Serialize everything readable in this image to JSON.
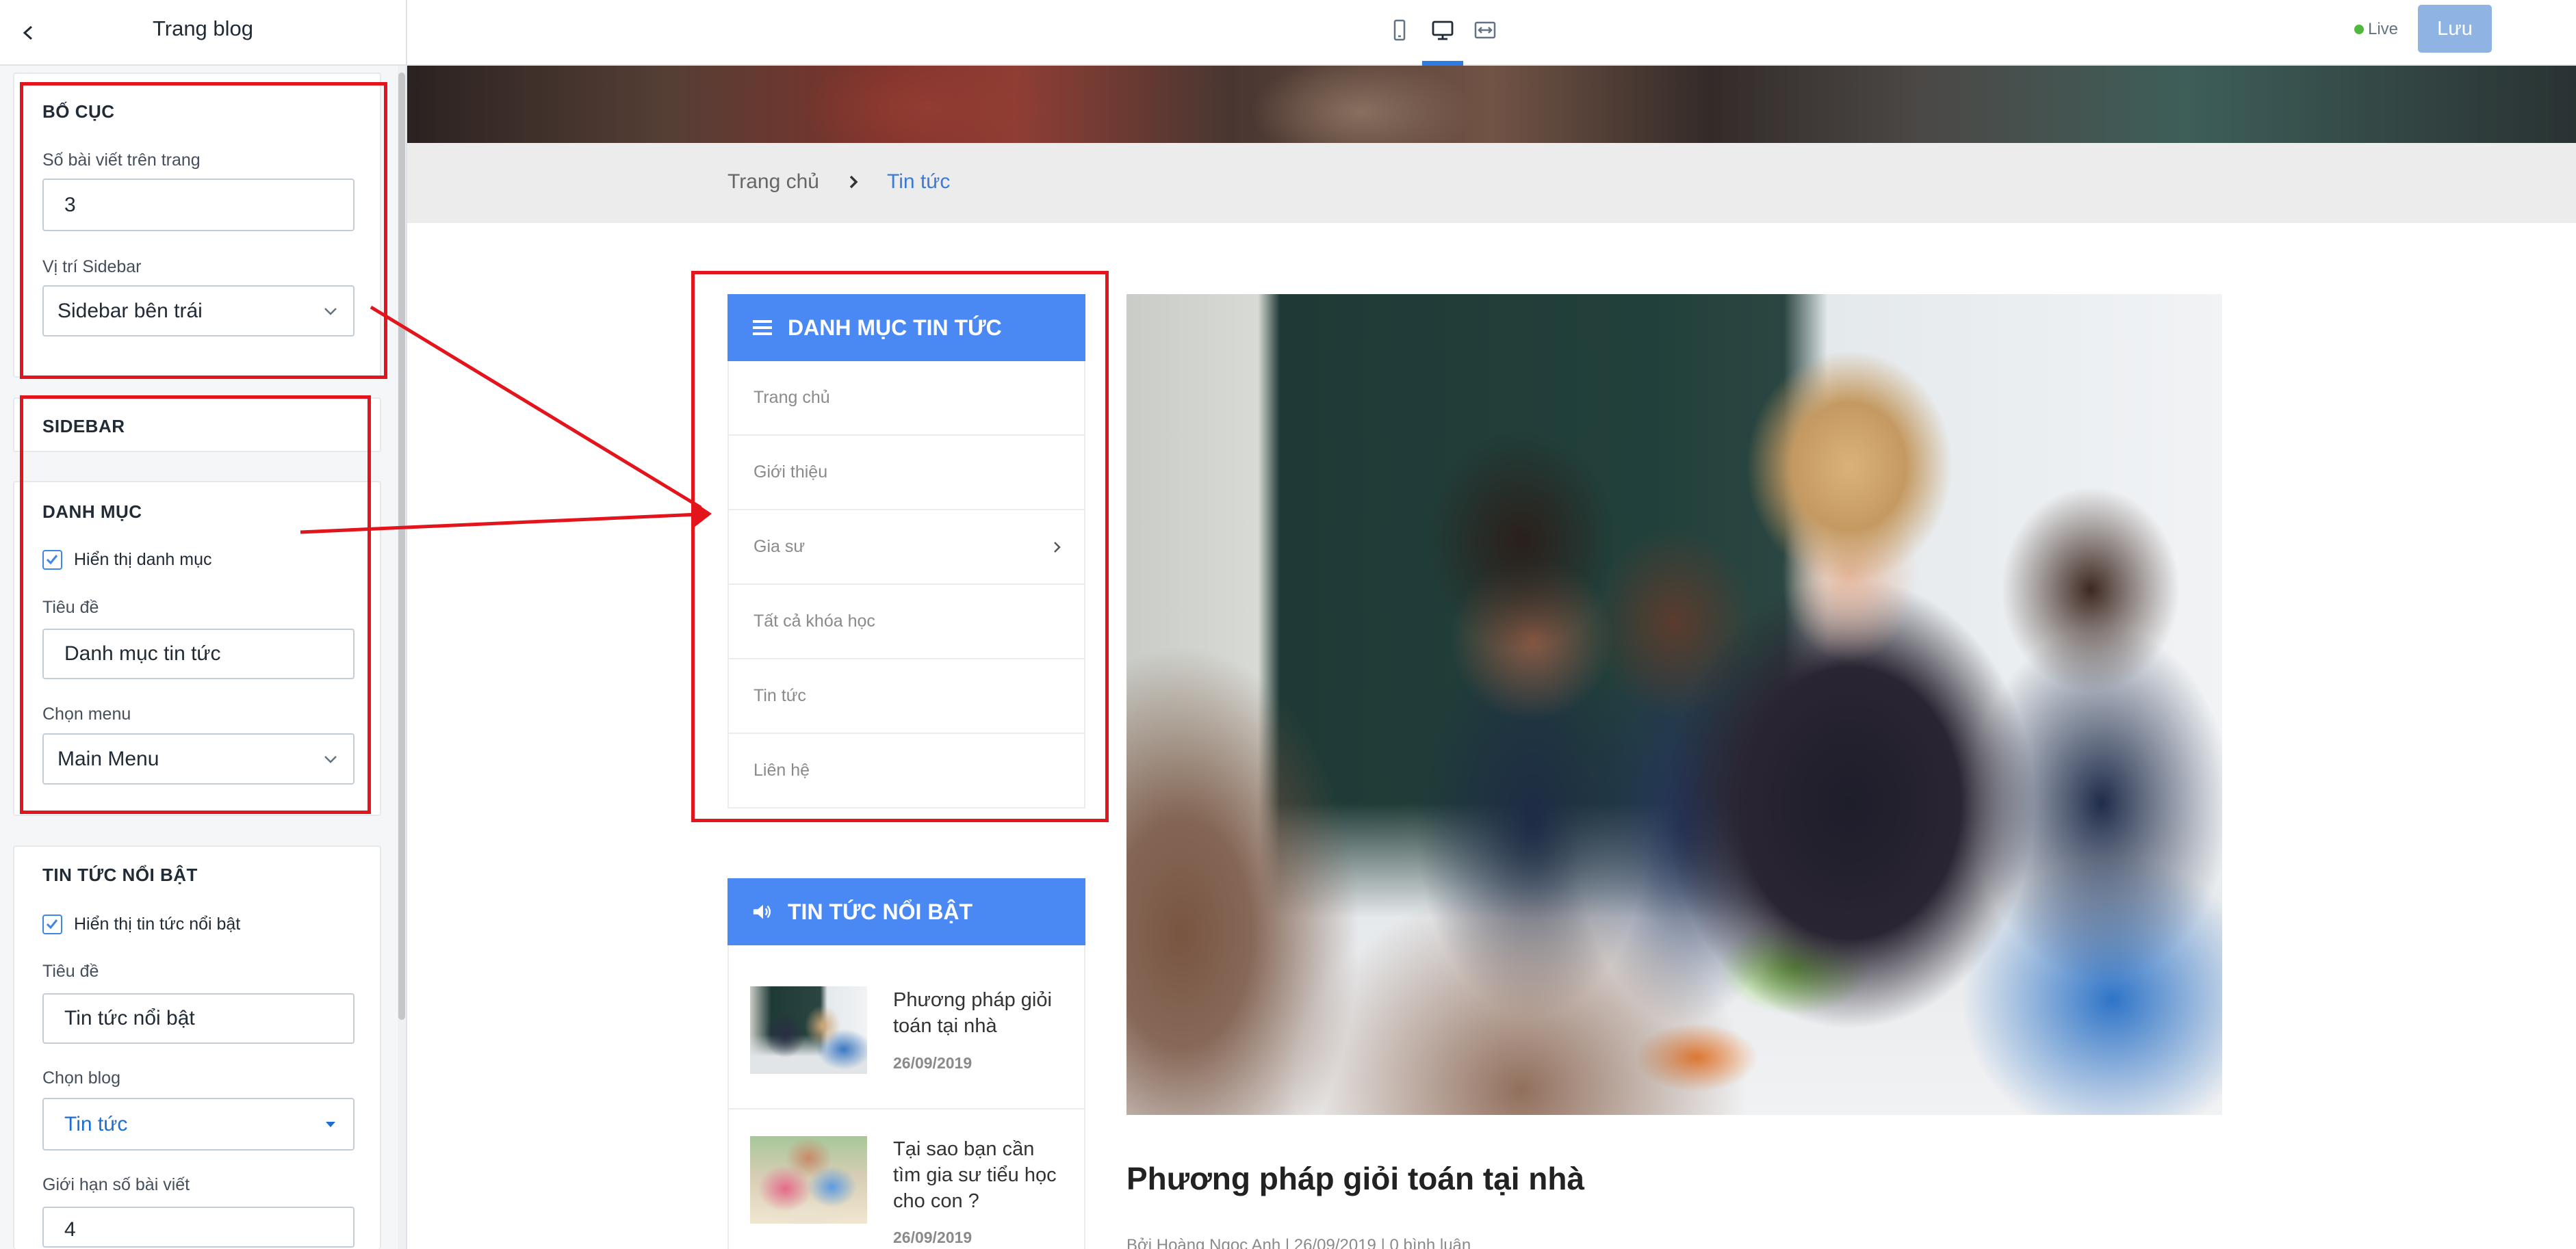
{
  "editor": {
    "title": "Trang blog",
    "back_icon": "chevron-left-icon",
    "layout": {
      "heading": "BỐ CỤC",
      "posts_per_page": {
        "label": "Số bài viết trên trang",
        "value": "3"
      },
      "sidebar_position": {
        "label": "Vị trí Sidebar",
        "value": "Sidebar bên trái"
      }
    },
    "sidebar": {
      "heading": "SIDEBAR"
    },
    "category": {
      "heading": "DANH MỤC",
      "show": {
        "label": "Hiển thị danh mục",
        "checked": true
      },
      "title": {
        "label": "Tiêu đề",
        "value": "Danh mục tin tức"
      },
      "menu": {
        "label": "Chọn menu",
        "value": "Main Menu"
      }
    },
    "featured": {
      "heading": "TIN TỨC NỔI BẬT",
      "show": {
        "label": "Hiển thị tin tức nổi bật",
        "checked": true
      },
      "title": {
        "label": "Tiêu đề",
        "value": "Tin tức nổi bật"
      },
      "blog": {
        "label": "Chọn blog",
        "value": "Tin tức"
      },
      "limit": {
        "label": "Giới hạn số bài viết",
        "value": "4"
      }
    }
  },
  "topbar": {
    "devices": [
      {
        "icon": "mobile-icon",
        "active": false
      },
      {
        "icon": "desktop-icon",
        "active": true
      },
      {
        "icon": "fullwidth-icon",
        "active": false
      }
    ],
    "status": "Live",
    "save_label": "Lưu"
  },
  "preview": {
    "breadcrumb": {
      "home": "Trang chủ",
      "separator_icon": "chevron-right-icon",
      "current": "Tin tức"
    },
    "category_widget": {
      "icon": "menu-icon",
      "title": "DANH MỤC TIN TỨC",
      "items": [
        {
          "label": "Trang chủ"
        },
        {
          "label": "Giới thiệu"
        },
        {
          "label": "Gia sư",
          "has_submenu": true
        },
        {
          "label": "Tất cả khóa học"
        },
        {
          "label": "Tin tức"
        },
        {
          "label": "Liên hệ"
        }
      ]
    },
    "featured_widget": {
      "icon": "megaphone-icon",
      "title": "TIN TỨC NỔI BẬT",
      "posts": [
        {
          "title": "Phương pháp giỏi toán tại nhà",
          "date": "26/09/2019"
        },
        {
          "title": "Tại sao bạn cần tìm gia sư tiểu học cho con ?",
          "date": "26/09/2019"
        }
      ]
    },
    "article": {
      "title": "Phương pháp giỏi toán tại nhà",
      "meta": "Bởi Hoàng Ngọc Anh | 26/09/2019 | 0 bình luận"
    }
  },
  "colors": {
    "widget_header": "#4a89f3",
    "link_blue": "#3a7bd5",
    "save_button": "#8fb4e3",
    "live_dot": "#50b83c",
    "annotation_red": "#e3141c",
    "breadcrumb_bar": "#ececec"
  }
}
